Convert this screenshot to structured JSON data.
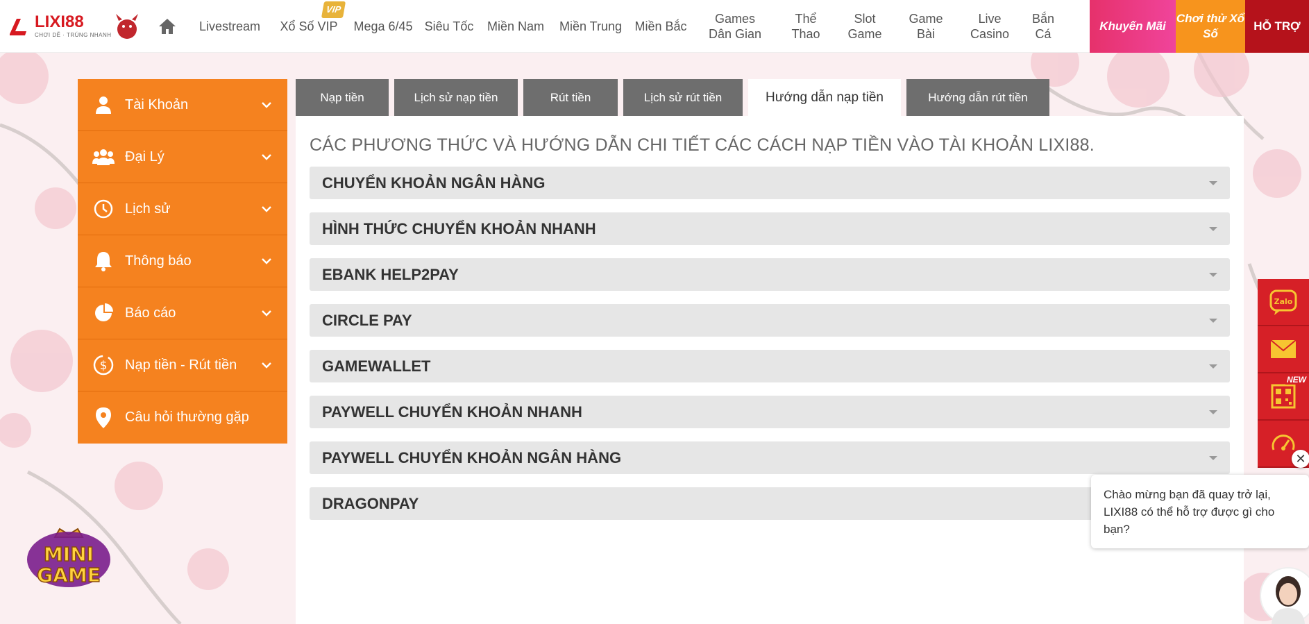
{
  "header": {
    "logo": {
      "title": "LIXI88",
      "tagline": "CHƠI DỄ · TRÚNG NHANH"
    },
    "nav": [
      {
        "label": "Livestream"
      },
      {
        "label": "Xổ Số VIP",
        "badge": "VIP"
      },
      {
        "label": "Mega 6/45"
      },
      {
        "label": "Siêu Tốc"
      },
      {
        "label": "Miền Nam"
      },
      {
        "label": "Miền Trung"
      },
      {
        "label": "Miền Bắc"
      },
      {
        "label": "Games Dân Gian"
      },
      {
        "label": "Thể Thao"
      },
      {
        "label": "Slot Game"
      },
      {
        "label": "Game Bài"
      },
      {
        "label": "Live Casino"
      },
      {
        "label": "Bắn Cá"
      }
    ],
    "promos": {
      "khuyen_mai": "Khuyến Mãi",
      "choi_thu": "Chơi thử Xổ Số",
      "ho_tro": "HỖ TRỢ"
    }
  },
  "sidebar": {
    "items": [
      {
        "label": "Tài Khoản",
        "icon": "user-icon"
      },
      {
        "label": "Đại Lý",
        "icon": "group-icon"
      },
      {
        "label": "Lịch sử",
        "icon": "history-icon"
      },
      {
        "label": "Thông báo",
        "icon": "bell-icon"
      },
      {
        "label": "Báo cáo",
        "icon": "pie-chart-icon"
      },
      {
        "label": "Nạp tiền - Rút tiền",
        "icon": "dollar-icon"
      },
      {
        "label": "Câu hỏi thường gặp",
        "icon": "location-pin-icon"
      }
    ]
  },
  "tabs": [
    {
      "label": "Nạp tiền"
    },
    {
      "label": "Lịch sử nạp tiền"
    },
    {
      "label": "Rút tiền"
    },
    {
      "label": "Lịch sử rút tiền"
    },
    {
      "label": "Hướng dẫn nạp tiền",
      "active": true
    },
    {
      "label": "Hướng dẫn rút tiền"
    }
  ],
  "main": {
    "title": "CÁC PHƯƠNG THỨC VÀ HƯỚNG DẪN CHI TIẾT CÁC CÁCH NẠP TIỀN VÀO TÀI KHOẢN LIXI88.",
    "accordion": [
      "CHUYỂN KHOẢN NGÂN HÀNG",
      "HÌNH THỨC CHUYỂN KHOẢN NHANH",
      "EBANK HELP2PAY",
      "CIRCLE PAY",
      "GAMEWALLET",
      "PAYWELL CHUYỂN KHOẢN NHANH",
      "PAYWELL CHUYỂN KHOẢN NGÂN HÀNG",
      "DRAGONPAY"
    ]
  },
  "float_bar": {
    "new_badge": "NEW",
    "buttons": [
      "zalo-icon",
      "mail-icon",
      "qr-code-icon",
      "speedometer-icon"
    ],
    "zalo_text": "Zalo"
  },
  "chat": {
    "close": "✕",
    "message": "Chào mừng bạn đã quay trở lại, LIXI88 có thể hỗ trợ được gì cho bạn?"
  },
  "mini_game": {
    "line1": "MINI",
    "line2": "GAME"
  },
  "colors": {
    "sidebar": "#f5821f",
    "tab_inactive": "#6e6e6e",
    "accordion": "#e6e6e6",
    "float_bar": "#d62027",
    "brand_red": "#d71920"
  }
}
